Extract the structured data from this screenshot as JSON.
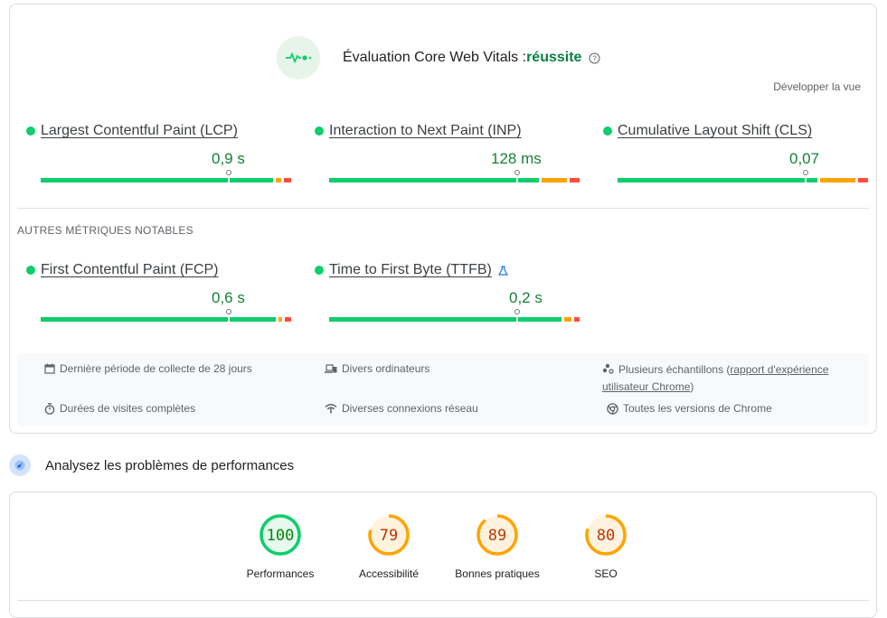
{
  "cwv": {
    "title": "Évaluation Core Web Vitals :",
    "status": "réussite",
    "expand_label": "Développer la vue",
    "metrics": [
      {
        "name": "Largest Contentful Paint (LCP)",
        "value": "0,9 s",
        "status": "good",
        "marker_fraction": 0.75,
        "segments_fraction": {
          "good": 0.94,
          "needs_improvement": 0.03,
          "poor": 0.03
        }
      },
      {
        "name": "Interaction to Next Paint (INP)",
        "value": "128 ms",
        "status": "good",
        "marker_fraction": 0.75,
        "segments_fraction": {
          "good": 0.85,
          "needs_improvement": 0.11,
          "poor": 0.04
        }
      },
      {
        "name": "Cumulative Layout Shift (CLS)",
        "value": "0,07",
        "status": "good",
        "marker_fraction": 0.75,
        "segments_fraction": {
          "good": 0.81,
          "needs_improvement": 0.15,
          "poor": 0.04
        }
      }
    ]
  },
  "other": {
    "section_label": "AUTRES MÉTRIQUES NOTABLES",
    "metrics": [
      {
        "name": "First Contentful Paint (FCP)",
        "value": "0,6 s",
        "status": "good",
        "marker_fraction": 0.75,
        "segments_fraction": {
          "good": 0.95,
          "needs_improvement": 0.025,
          "poor": 0.025
        }
      },
      {
        "name": "Time to First Byte (TTFB)",
        "value": "0,2 s",
        "status": "good",
        "experimental": true,
        "marker_fraction": 0.75,
        "segments_fraction": {
          "good": 0.94,
          "needs_improvement": 0.04,
          "poor": 0.02
        }
      }
    ]
  },
  "info": {
    "collection_period": "Dernière période de collecte de 28 jours",
    "devices": "Divers ordinateurs",
    "samples_prefix": "Plusieurs échantillons (",
    "samples_link": "rapport d'expérience utilisateur Chrome",
    "samples_suffix": ")",
    "visit_durations": "Durées de visites complètes",
    "connections": "Diverses connexions réseau",
    "chrome_versions": "Toutes les versions de Chrome"
  },
  "performance": {
    "heading": "Analysez les problèmes de performances",
    "scores": [
      {
        "label": "Performances",
        "score": "100",
        "fraction": 1.0,
        "rating": "pass"
      },
      {
        "label": "Accessibilité",
        "score": "79",
        "fraction": 0.79,
        "rating": "average"
      },
      {
        "label": "Bonnes pratiques",
        "score": "89",
        "fraction": 0.89,
        "rating": "average"
      },
      {
        "label": "SEO",
        "score": "80",
        "fraction": 0.8,
        "rating": "average"
      }
    ]
  },
  "colors": {
    "good": "#0cce6b",
    "needs_improvement": "#ffa400",
    "poor": "#ff4e42",
    "status_text": "#188038"
  }
}
